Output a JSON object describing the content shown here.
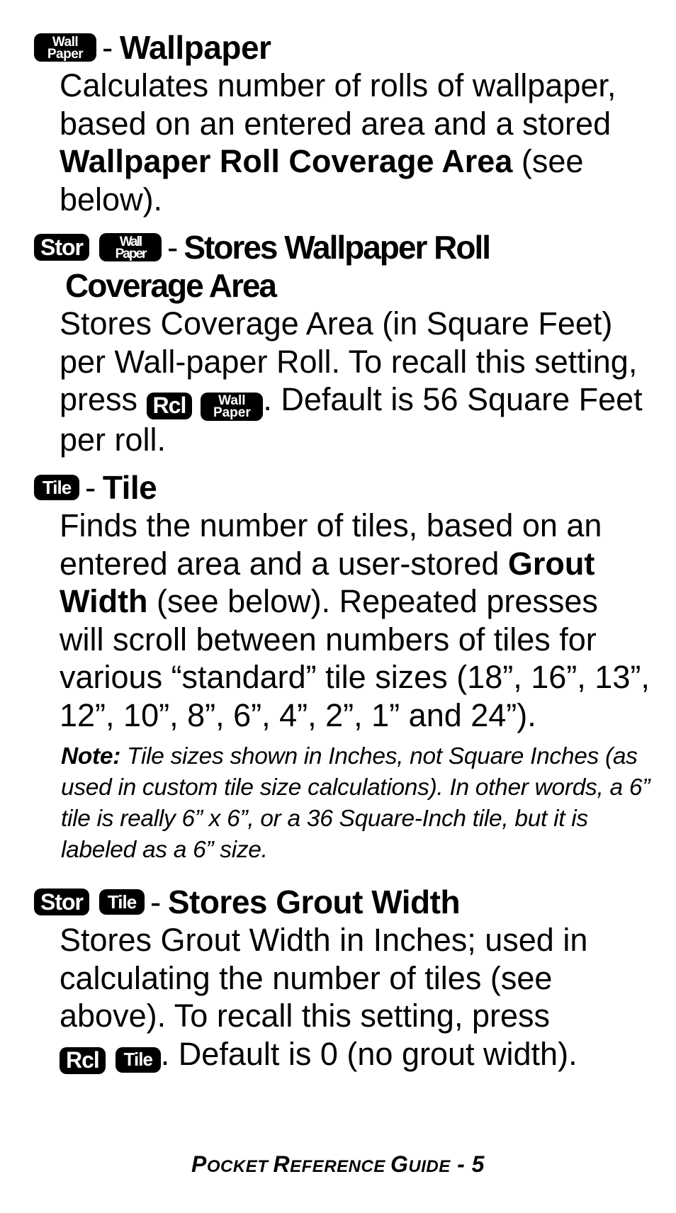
{
  "keys": {
    "wallpaper_line1": "Wall",
    "wallpaper_line2": "Paper",
    "stor": "Stor",
    "rcl": "Rcl",
    "tile": "Tile"
  },
  "sections": [
    {
      "title": "Wallpaper",
      "body_pre": "Calculates number of rolls of wallpaper, based on an entered area and a stored ",
      "body_bold": "Wallpaper Roll Coverage Area",
      "body_post": " (see below)."
    },
    {
      "title_line1": "Stores Wallpaper Roll",
      "title_line2": "Coverage Area",
      "body_pre": "Stores Coverage Area (in Square Feet) per Wall-paper Roll. To recall this setting, press ",
      "body_post": ". Default is 56 Square Feet per roll."
    },
    {
      "title": "Tile",
      "body_pre": "Finds the number of tiles, based on an entered area and a user-stored ",
      "body_bold": "Grout Width",
      "body_post": " (see below). Repeated presses will scroll between numbers of tiles for various “standard” tile sizes (18”, 16”, 13”, 12”, 10”, 8”, 6”, 4”, 2”, 1” and 24”).",
      "note_label": "Note:",
      "note_text": " Tile sizes shown in Inches, not Square Inches (as used in custom tile size calculations). In other words, a 6” tile is really 6” x 6”, or a 36 Square-Inch tile, but it is labeled as a 6” size."
    },
    {
      "title": "Stores Grout Width",
      "body_pre": "Stores Grout Width in Inches; used in calculating the number of tiles (see above). To recall this setting, press ",
      "body_post": ". Default is 0 (no grout width)."
    }
  ],
  "separator": "-",
  "footer": {
    "p1": "P",
    "p2": "OCKET ",
    "r1": "R",
    "r2": "EFERENCE ",
    "g1": "G",
    "g2": "UIDE",
    "page": " - 5"
  }
}
